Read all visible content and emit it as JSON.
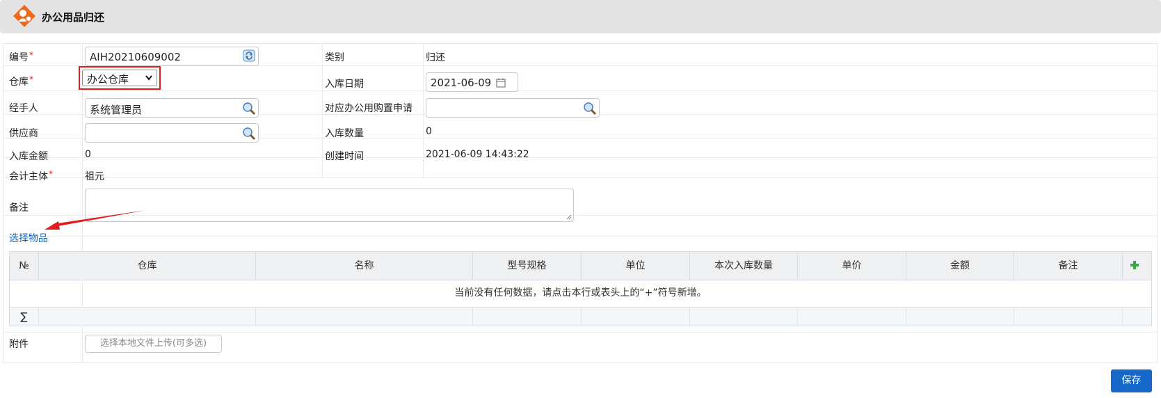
{
  "header": {
    "title": "办公用品归还"
  },
  "form": {
    "code": {
      "label": "编号",
      "value": "AIH20210609002"
    },
    "category": {
      "label": "类别",
      "value": "归还"
    },
    "warehouse": {
      "label": "仓库",
      "value": "办公仓库"
    },
    "in_date": {
      "label": "入库日期",
      "value": "2021-06-09"
    },
    "handler": {
      "label": "经手人",
      "value": "系统管理员"
    },
    "purchase_request": {
      "label": "对应办公用购置申请",
      "value": ""
    },
    "supplier": {
      "label": "供应商",
      "value": ""
    },
    "in_quantity": {
      "label": "入库数量",
      "value": "0"
    },
    "in_amount": {
      "label": "入库金额",
      "value": "0"
    },
    "created_time": {
      "label": "创建时间",
      "value": "2021-06-09 14:43:22"
    },
    "accounting_entity": {
      "label": "会计主体",
      "value": "祖元"
    },
    "remark": {
      "label": "备注",
      "value": ""
    },
    "required_mark": "*"
  },
  "select_items_link": "选择物品",
  "grid": {
    "columns": [
      "№",
      "仓库",
      "名称",
      "型号规格",
      "单位",
      "本次入库数量",
      "单价",
      "金额",
      "备注"
    ],
    "empty_message": "当前没有任何数据，请点击本行或表头上的“+”符号新增。",
    "sum_symbol": "∑"
  },
  "attachment": {
    "label": "附件",
    "button": "选择本地文件上传(可多选)"
  },
  "save_button": "保存",
  "colors": {
    "accent": "#1769c9",
    "logo": "#f06a1b",
    "required": "#e02020",
    "highlight": "#e01e1e"
  }
}
